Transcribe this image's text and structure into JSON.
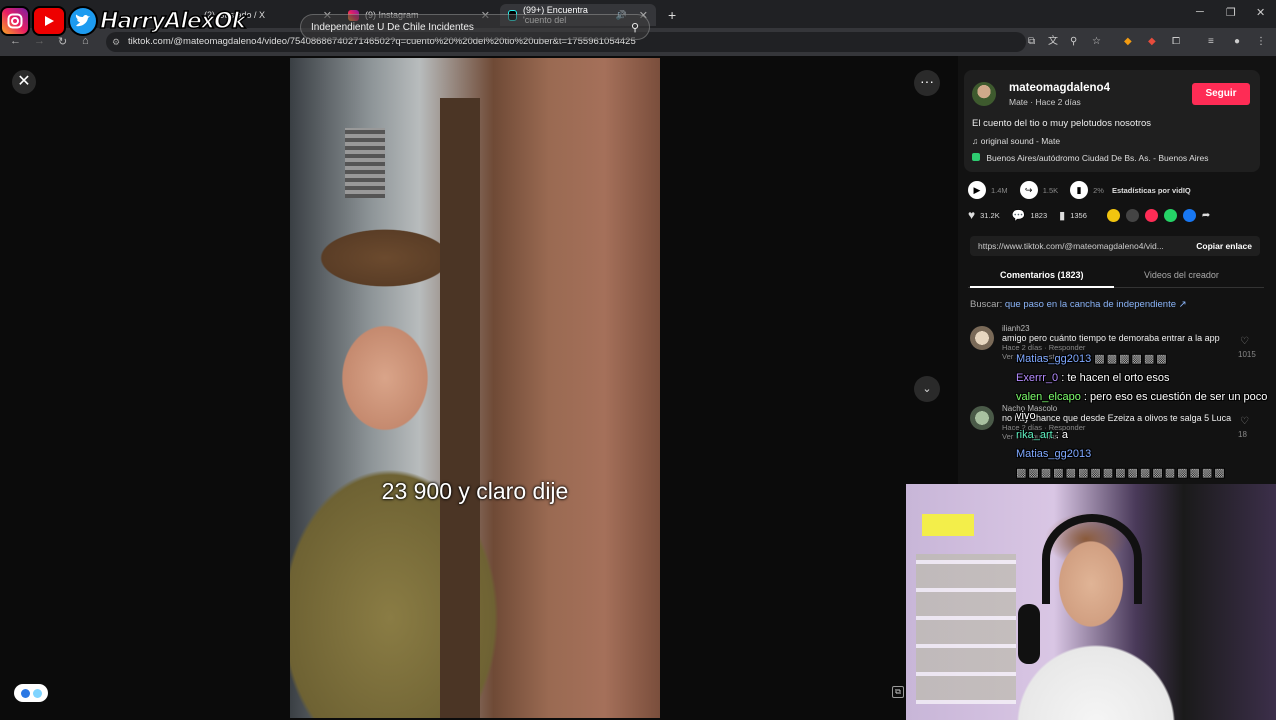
{
  "overlay": {
    "streamer_name": "HarryAlexOk"
  },
  "browser": {
    "tabs": [
      {
        "label": "(2) Gustado / X",
        "icon": "x-icon"
      },
      {
        "label": "(9) Instagram",
        "icon": "instagram-icon"
      },
      {
        "label": "(99+) Encuentra 'cuento del",
        "icon": "tiktok-icon"
      }
    ],
    "url": "tiktok.com/@mateomagdaleno4/video/7540868674027146502?q=cuento%20%20del%20tio%20uber&t=1755961054425"
  },
  "video": {
    "search_placeholder": "Independiente U De Chile Incidentes",
    "caption": "23 900 y claro dije"
  },
  "post": {
    "author": "mateomagdaleno4",
    "author_sub": "Mate · Hace 2 días",
    "follow_label": "Seguir",
    "description": "El cuento del tio o muy pelotudos nosotros",
    "sound": "original sound - Mate",
    "location": "Buenos Aires/autódromo Ciudad De Bs. As. - Buenos Aires",
    "stats_top": {
      "plays": "1.4M",
      "shares": "1.5K",
      "pct": "2%",
      "stats_label": "Estadísticas por vidIQ"
    },
    "stats": {
      "likes": "31.2K",
      "comments": "1823",
      "saves": "1356"
    },
    "link": "https://www.tiktok.com/@mateomagdaleno4/vid...",
    "copy_label": "Copiar enlace",
    "tab_comments": "Comentarios (1823)",
    "tab_creator": "Videos del creador",
    "search_label": "Buscar:",
    "search_query": "que paso en la cancha de independiente",
    "comments": [
      {
        "user": "ilianh23",
        "text": "amigo pero cuánto tiempo te demoraba entrar a la app",
        "meta": "Hace 2 días · Responder",
        "replies": "Ver 29 respuestas",
        "likes": "1015"
      },
      {
        "user": "Nacho Mascolo",
        "text": "no hay chance que desde Ezeiza a olivos te salga 5 Luca",
        "meta": "Hace 2 días · Responder",
        "replies": "Ver 9 respuestas",
        "likes": "18"
      }
    ]
  },
  "chat": [
    {
      "user": "Matias_gg2013",
      "msg": ""
    },
    {
      "user": "Exerrr_0",
      "msg": ": te hacen el orto esos"
    },
    {
      "user": "valen_elcapo",
      "msg": ": pero eso es cuestión de ser un poco vivo"
    },
    {
      "user": "rika_art",
      "msg": ": a"
    },
    {
      "user": "Matias_gg2013",
      "msg": ""
    }
  ],
  "colors": {
    "accent": "#fe2c55",
    "link": "#8ab4f8"
  }
}
